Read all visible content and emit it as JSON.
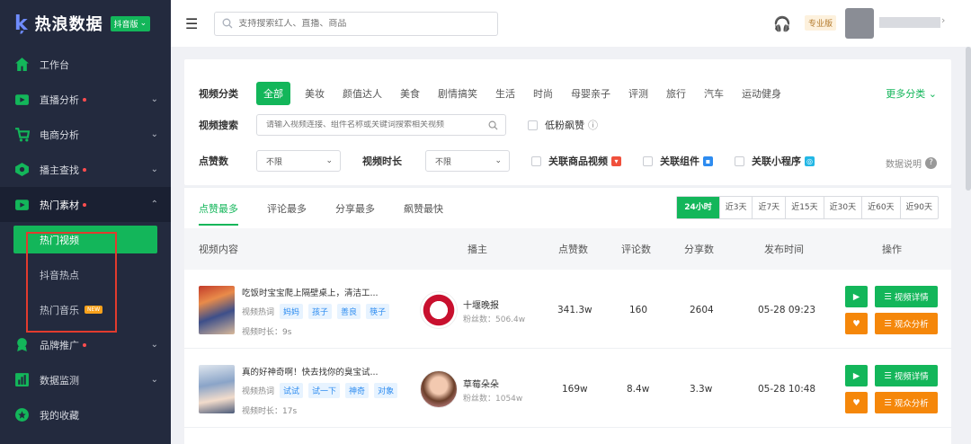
{
  "brand": {
    "logo_text": "热浪数据",
    "version": "抖音版"
  },
  "sidebar": {
    "items": [
      {
        "label": "工作台",
        "icon": "home-icon"
      },
      {
        "label": "直播分析",
        "icon": "live-icon",
        "dot": true
      },
      {
        "label": "电商分析",
        "icon": "cart-icon",
        "dot": false
      },
      {
        "label": "播主查找",
        "icon": "anchor-icon",
        "dot": true
      },
      {
        "label": "热门素材",
        "icon": "video-icon",
        "dot": true
      },
      {
        "label": "品牌推广",
        "icon": "brand-icon",
        "dot": true
      },
      {
        "label": "数据监测",
        "icon": "chart-icon",
        "dot": false
      },
      {
        "label": "我的收藏",
        "icon": "star-icon",
        "dot": false
      }
    ],
    "sub_items": [
      {
        "label": "热门视频"
      },
      {
        "label": "抖音热点"
      },
      {
        "label": "热门音乐",
        "badge": "NEW"
      }
    ]
  },
  "header": {
    "search_placeholder": "支持搜索红人、直播、商品",
    "plan": "专业版"
  },
  "filters": {
    "category_label": "视频分类",
    "categories": [
      "全部",
      "美妆",
      "颜值达人",
      "美食",
      "剧情搞笑",
      "生活",
      "时尚",
      "母婴亲子",
      "评测",
      "旅行",
      "汽车",
      "运动健身"
    ],
    "more": "更多分类",
    "search_label": "视频搜索",
    "search_placeholder": "请输入视频连接、组件名称或关键词搜索相关视频",
    "low_fans": "低粉飙赞",
    "likes_label": "点赞数",
    "likes_value": "不限",
    "duration_label": "视频时长",
    "duration_value": "不限",
    "check_goods": "关联商品视频",
    "check_component": "关联组件",
    "check_miniapp": "关联小程序",
    "data_help": "数据说明"
  },
  "tabs": [
    "点赞最多",
    "评论最多",
    "分享最多",
    "飙赞最快"
  ],
  "periods": [
    "24小时",
    "近3天",
    "近7天",
    "近15天",
    "近30天",
    "近60天",
    "近90天"
  ],
  "table": {
    "headers": [
      "视频内容",
      "播主",
      "点赞数",
      "评论数",
      "分享数",
      "发布时间",
      "操作"
    ],
    "rows": [
      {
        "title": "吃饭时宝宝爬上隔壁桌上，清洁工...",
        "tag_label": "视频热词",
        "tags": [
          "妈妈",
          "孩子",
          "善良",
          "筷子"
        ],
        "duration": "视频时长：9s",
        "author": "十堰晚报",
        "fans": "粉丝数：506.4w",
        "likes": "341.3w",
        "comments": "160",
        "shares": "2604",
        "time": "05-28 09:23"
      },
      {
        "title": "真的好神奇啊！快去找你的臭宝试...",
        "tag_label": "视频热词",
        "tags": [
          "试试",
          "试一下",
          "神奇",
          "对象"
        ],
        "duration": "视频时长：17s",
        "author": "草莓朵朵",
        "fans": "粉丝数：1054w",
        "likes": "169w",
        "comments": "8.4w",
        "shares": "3.3w",
        "time": "05-28 10:48"
      }
    ],
    "op_detail": "视频详情",
    "op_audience": "观众分析"
  },
  "colors": {
    "accent": "#13b65a",
    "sidebar": "#232a3e",
    "orange": "#f5870a",
    "highlight": "#e23b2e"
  }
}
